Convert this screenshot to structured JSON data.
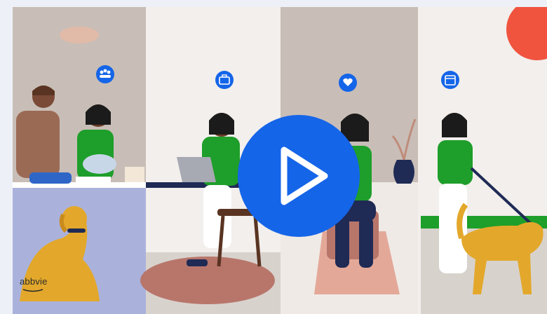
{
  "video": {
    "brand_text": "abbvie",
    "play_label": "Play video",
    "colors": {
      "background": "#eef0f8",
      "accent_blue": "#1565e8",
      "shirt_green": "#1e9e2a",
      "dog_yellow": "#e3a82b",
      "sun_red": "#f0543f",
      "rug_brown": "#b8766b",
      "navy": "#1f2a55"
    },
    "scenes": [
      {
        "name": "family",
        "icon": "people-icon"
      },
      {
        "name": "work",
        "icon": "briefcase-icon"
      },
      {
        "name": "care",
        "icon": "heart-hands-icon"
      },
      {
        "name": "calendar",
        "icon": "calendar-icon"
      }
    ]
  }
}
